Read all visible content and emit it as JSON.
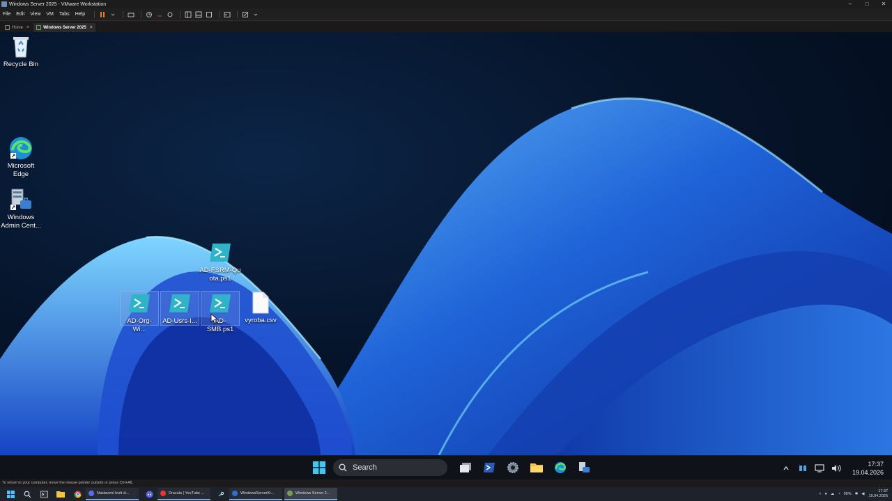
{
  "host_window": {
    "title": "Windows Server 2025 - VMware Workstation",
    "controls": [
      "–",
      "□",
      "✕"
    ]
  },
  "menu": {
    "items": [
      "File",
      "Edit",
      "View",
      "VM",
      "Tabs",
      "Help"
    ]
  },
  "tabs": [
    {
      "label": "Home"
    },
    {
      "label": "Windows Server 2025"
    }
  ],
  "desktop_icons": [
    {
      "label": "Recycle Bin",
      "icon": "recycle-bin-icon"
    },
    {
      "label": "Microsoft Edge",
      "icon": "edge-icon"
    },
    {
      "label": "Windows Admin Cent...",
      "icon": "admin-center-icon"
    },
    {
      "label": "AD-FSRM-Quota.ps1",
      "icon": "powershell-script-icon"
    },
    {
      "label": "AD-Org-Wi...",
      "icon": "powershell-script-icon",
      "selected": true
    },
    {
      "label": "AD-Usrs-I...",
      "icon": "powershell-script-icon",
      "selected": true
    },
    {
      "label": "AD-SMB.ps1",
      "icon": "powershell-script-icon",
      "selected": true
    },
    {
      "label": "vyroba.csv",
      "icon": "file-icon"
    }
  ],
  "guest_taskbar": {
    "search_placeholder": "Search",
    "pinned": [
      "start-icon",
      "task-view-icon",
      "powershell-icon",
      "settings-icon",
      "file-explorer-icon",
      "edge-icon",
      "server-manager-icon"
    ],
    "clock_time": "17:37",
    "clock_date": "19.04.2026"
  },
  "host_status": {
    "text": "To return to your computer, move the mouse pointer outside or press Ctrl+Alt."
  },
  "host_taskbar": {
    "apps": [
      {
        "label": "Nastavení kvót sl...",
        "color": "#5a6cf0"
      },
      {
        "label": "Dracula | YouTube ...",
        "color": "#e33"
      },
      {
        "label": "WindowsServerKr...",
        "color": "#2f6fd1"
      },
      {
        "label": "Windows Server 2...",
        "color": "#7a9c5a",
        "active": true
      }
    ],
    "battery": "99%",
    "clock_time": "17:37",
    "clock_date": "19.04.2026"
  }
}
